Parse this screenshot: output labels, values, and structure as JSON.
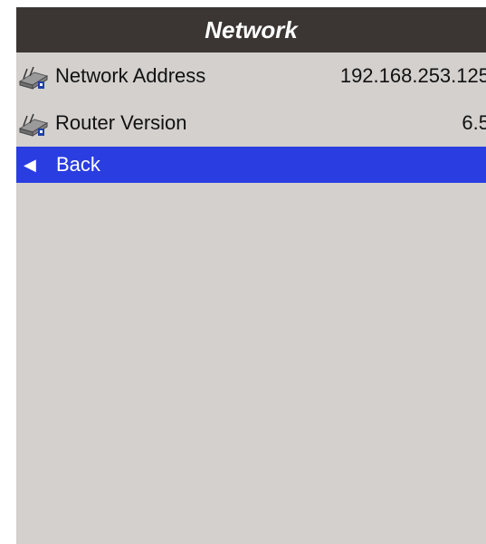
{
  "header": {
    "title": "Network"
  },
  "items": [
    {
      "label": "Network Address",
      "value": "192.168.253.125",
      "icon": "router-icon"
    },
    {
      "label": "Router Version",
      "value": "6.5",
      "icon": "router-icon"
    }
  ],
  "back": {
    "label": "Back",
    "icon": "triangle-left-icon"
  },
  "colors": {
    "title_bar": "#3b3634",
    "background": "#d3d0ce",
    "highlight": "#2a3de0"
  }
}
